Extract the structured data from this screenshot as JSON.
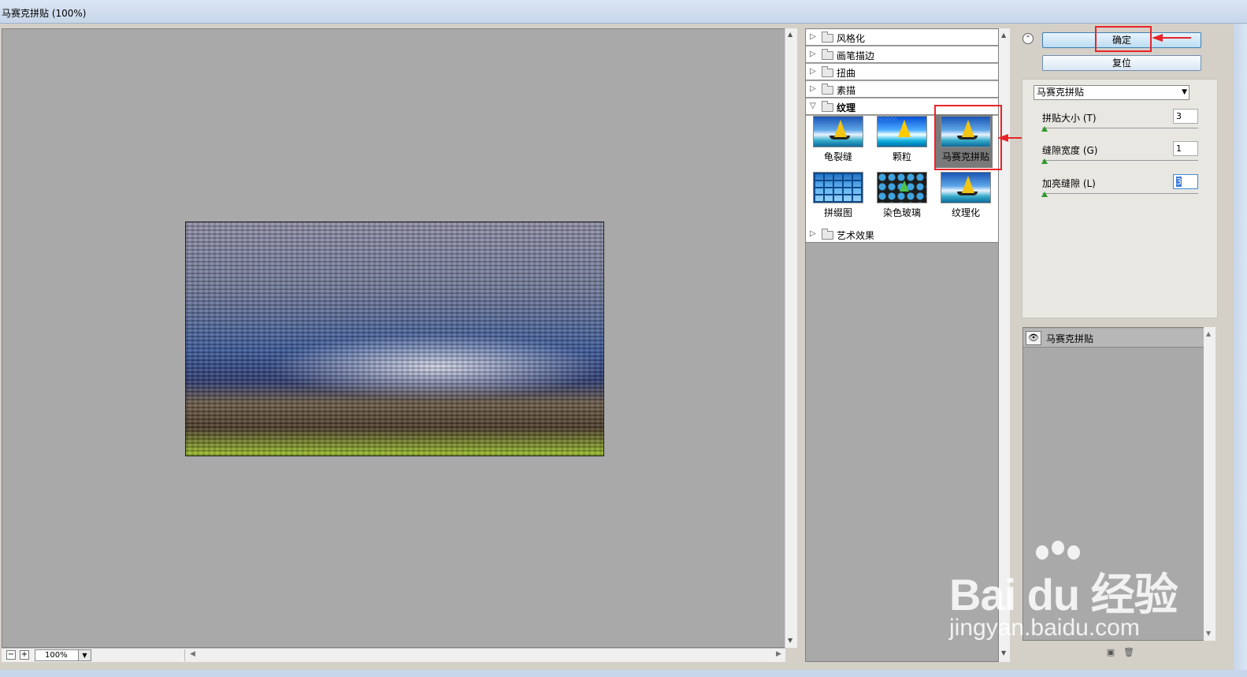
{
  "window": {
    "title": "马赛克拼贴 (100%)"
  },
  "preview": {
    "zoom": "100%",
    "zoom_out": "−",
    "zoom_in": "+"
  },
  "gallery": {
    "categories": [
      {
        "label": "风格化",
        "expanded": false
      },
      {
        "label": "画笔描边",
        "expanded": false
      },
      {
        "label": "扭曲",
        "expanded": false
      },
      {
        "label": "素描",
        "expanded": false
      },
      {
        "label": "纹理",
        "expanded": true
      },
      {
        "label": "艺术效果",
        "expanded": false
      }
    ],
    "filters": [
      {
        "label": "龟裂缝",
        "selected": false
      },
      {
        "label": "颗粒",
        "selected": false
      },
      {
        "label": "马赛克拼贴",
        "selected": true
      },
      {
        "label": "拼缀图",
        "selected": false
      },
      {
        "label": "染色玻璃",
        "selected": false
      },
      {
        "label": "纹理化",
        "selected": false
      }
    ]
  },
  "buttons": {
    "ok": "确定",
    "reset": "复位"
  },
  "settings": {
    "filter_select": "马赛克拼贴",
    "params": [
      {
        "label": "拼贴大小 (T)",
        "value": "3"
      },
      {
        "label": "缝隙宽度 (G)",
        "value": "1"
      },
      {
        "label": "加亮缝隙 (L)",
        "value": "3"
      }
    ]
  },
  "layers": {
    "items": [
      {
        "label": "马赛克拼贴",
        "visible": true
      }
    ]
  },
  "watermark": {
    "brand": "Bai du 经验",
    "site": "jingyan.baidu.com"
  },
  "colors": {
    "highlight": "#e8242a",
    "canvas_bg": "#a9a9a9",
    "slider_knob": "#2a9a2a"
  }
}
